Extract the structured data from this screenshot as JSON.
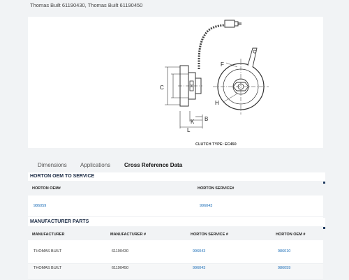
{
  "header": {
    "breadcrumb_text": "Thomas Built 61190430, Thomas Built 61190450"
  },
  "figure": {
    "caption": "CLUTCH TYPE: EC450",
    "labels": {
      "C": "C",
      "F": "F",
      "H": "H",
      "K": "K",
      "B": "B",
      "L": "L"
    }
  },
  "tabs": [
    {
      "label": "Dimensions",
      "active": false
    },
    {
      "label": "Applications",
      "active": false
    },
    {
      "label": "Cross Reference Data",
      "active": true
    }
  ],
  "horton_section": {
    "title": "HORTON OEM TO SERVICE",
    "columns": [
      "HORTON OEM#",
      "HORTON SERVICE#"
    ],
    "rows": [
      {
        "oem": "986059",
        "service": "996043"
      }
    ]
  },
  "manufacturer_section": {
    "title": "MANUFACTURER PARTS",
    "columns": [
      "MANUFACTURER",
      "MANUFACTURER #",
      "HORTON SERVICE #",
      "HORTON OEM #"
    ],
    "rows": [
      {
        "manufacturer": "THOMAS BUILT",
        "mfr_num": "61190430",
        "service": "996043",
        "oem": "986010"
      },
      {
        "manufacturer": "THOMAS BUILT",
        "mfr_num": "61190450",
        "service": "996043",
        "oem": "986059"
      }
    ]
  },
  "colors": {
    "link": "#1d6fb8",
    "accent": "#1f3a5f",
    "tab_underline": "#1f4e8c"
  }
}
